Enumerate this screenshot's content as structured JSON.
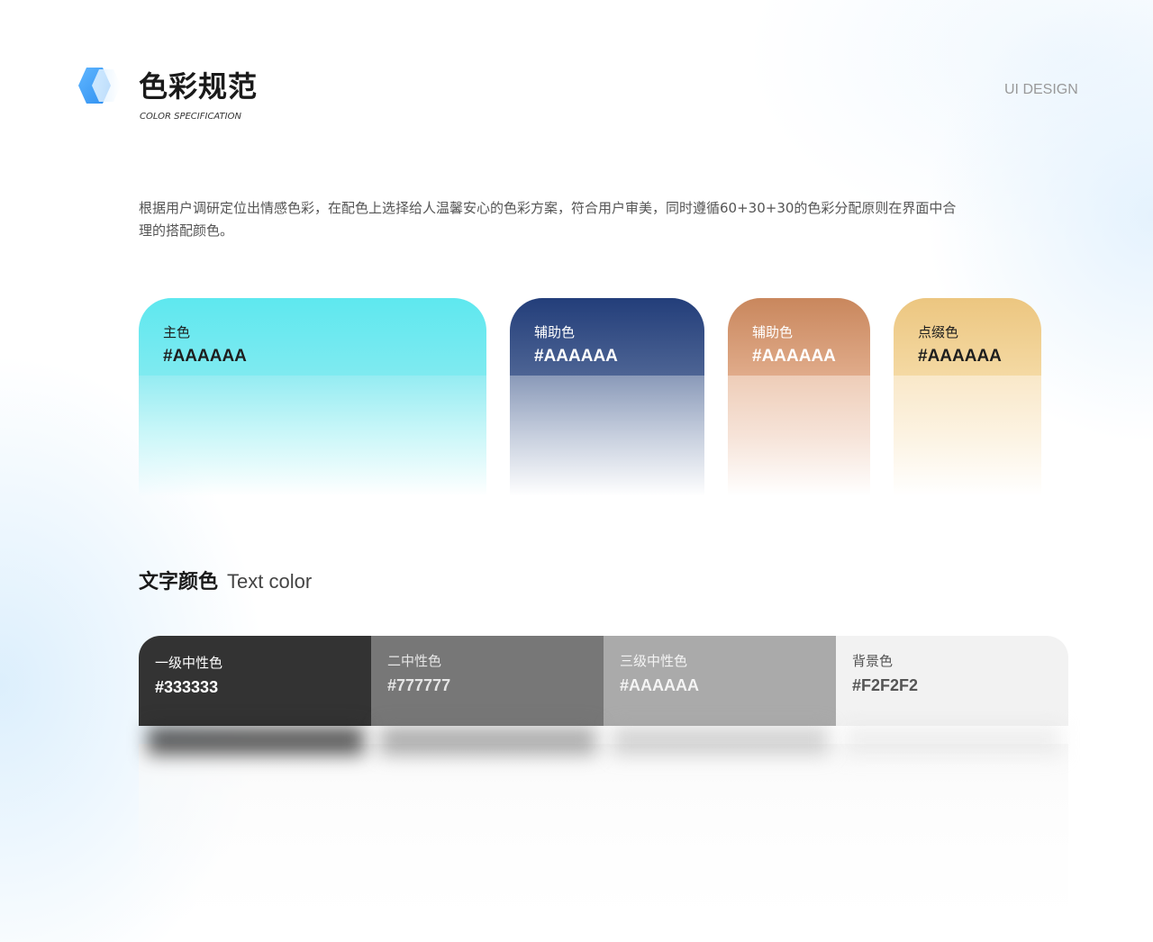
{
  "header": {
    "title": "色彩规范",
    "subtitle": "COLOR SPECIFICATION",
    "tag": "UI DESIGN",
    "logo_icon": "hexagon-logo-icon"
  },
  "intro": "根据用户调研定位出情感色彩，在配色上选择给人温馨安心的色彩方案，符合用户审美，同时遵循60+30+30的色彩分配原则在界面中合理的搭配颜色。",
  "palette": [
    {
      "label": "主色",
      "hex": "#AAAAAA",
      "color": "#5EE8EF"
    },
    {
      "label": "辅助色",
      "hex": "#AAAAAA",
      "color": "#233E7A"
    },
    {
      "label": "辅助色",
      "hex": "#AAAAAA",
      "color": "#C9875D"
    },
    {
      "label": "点缀色",
      "hex": "#AAAAAA",
      "color": "#ECC680"
    }
  ],
  "text_colors": {
    "title_zh": "文字颜色",
    "title_en": "Text color",
    "swatches": [
      {
        "label": "一级中性色",
        "hex": "#333333",
        "color": "#333333"
      },
      {
        "label": "二中性色",
        "hex": "#777777",
        "color": "#777777"
      },
      {
        "label": "三级中性色",
        "hex": "#AAAAAA",
        "color": "#AAAAAA"
      },
      {
        "label": "背景色",
        "hex": "#F2F2F2",
        "color": "#F2F2F2"
      }
    ]
  }
}
